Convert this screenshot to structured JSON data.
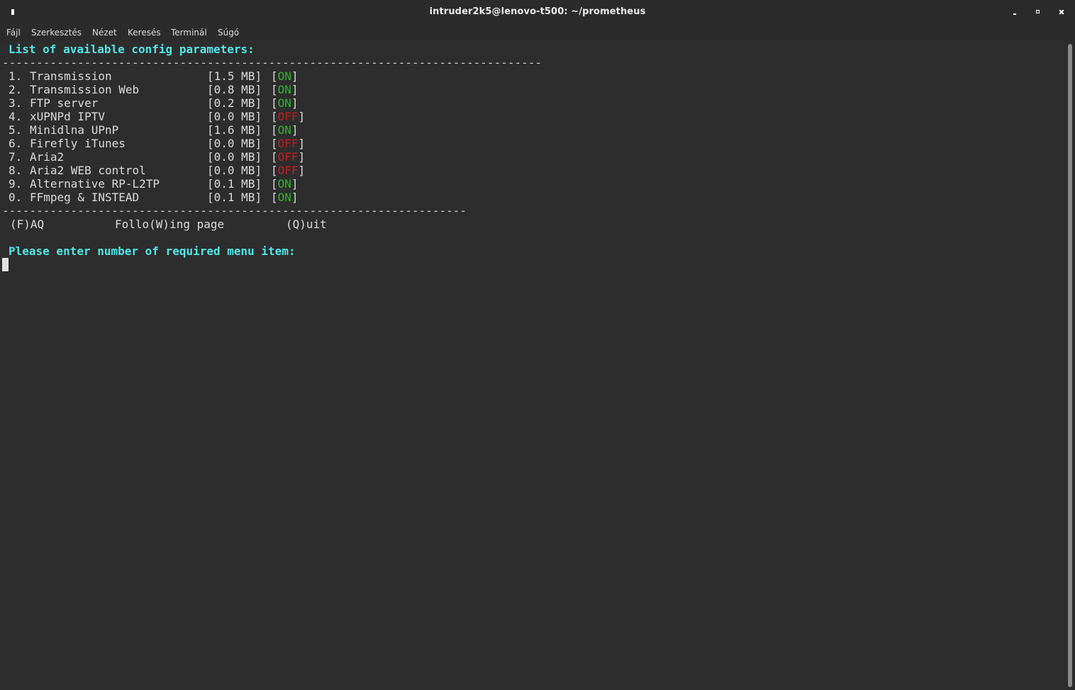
{
  "window": {
    "title": "intruder2k5@lenovo-t500: ~/prometheus"
  },
  "menubar": {
    "items": [
      "Fájl",
      "Szerkesztés",
      "Nézet",
      "Keresés",
      "Terminál",
      "Súgó"
    ]
  },
  "terminal": {
    "heading": "List of available config parameters:",
    "separator_top": "-------------------------------------------------------------------------------",
    "items": [
      {
        "num": "1.",
        "name": "Transmission",
        "size": "1.5 MB",
        "status": "ON"
      },
      {
        "num": "2.",
        "name": "Transmission Web",
        "size": "0.8 MB",
        "status": "ON"
      },
      {
        "num": "3.",
        "name": "FTP server",
        "size": "0.2 MB",
        "status": "ON"
      },
      {
        "num": "4.",
        "name": "xUPNPd IPTV",
        "size": "0.0 MB",
        "status": "OFF"
      },
      {
        "num": "5.",
        "name": "Minidlna UPnP",
        "size": "1.6 MB",
        "status": "ON"
      },
      {
        "num": "6.",
        "name": "Firefly iTunes",
        "size": "0.0 MB",
        "status": "OFF"
      },
      {
        "num": "7.",
        "name": "Aria2",
        "size": "0.0 MB",
        "status": "OFF"
      },
      {
        "num": "8.",
        "name": "Aria2 WEB control",
        "size": "0.0 MB",
        "status": "OFF"
      },
      {
        "num": "9.",
        "name": "Alternative RP-L2TP",
        "size": "0.1 MB",
        "status": "ON"
      },
      {
        "num": "0.",
        "name": "FFmpeg & INSTEAD",
        "size": "0.1 MB",
        "status": "ON"
      }
    ],
    "separator_bottom": "--------------------------------------------------------------------",
    "options": {
      "faq": "(F)AQ",
      "following": "Follo(W)ing page",
      "quit": "(Q)uit"
    },
    "prompt": "Please enter number of required menu item:"
  },
  "colors": {
    "heading": "#55e6e6",
    "on": "#2bb52b",
    "off": "#c41d1d",
    "background": "#2d2d2d"
  }
}
